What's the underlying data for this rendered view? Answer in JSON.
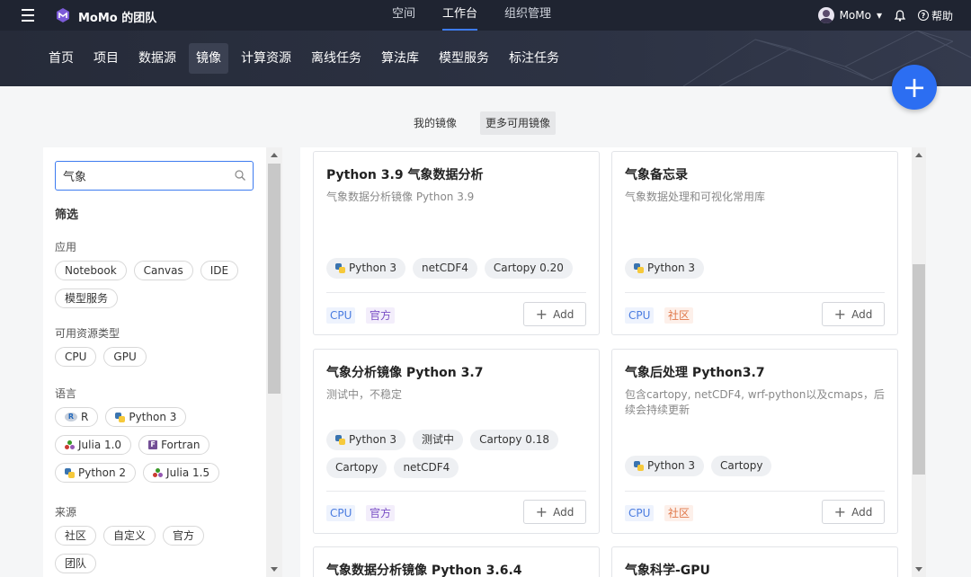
{
  "topbar": {
    "team_name": "MoMo 的团队",
    "nav": [
      "空间",
      "工作台",
      "组织管理"
    ],
    "active_nav": 1,
    "user_name": "MoMo",
    "user_chevron": "▾",
    "bell_glyph": "🔔",
    "help_glyph": "?",
    "help_label": "帮助"
  },
  "subnav": {
    "items": [
      "首页",
      "项目",
      "数据源",
      "镜像",
      "计算资源",
      "离线任务",
      "算法库",
      "模型服务",
      "标注任务"
    ],
    "active": 3
  },
  "fab": {
    "glyph": "+"
  },
  "tabs": {
    "mine": "我的镜像",
    "more": "更多可用镜像"
  },
  "filter": {
    "search_value": "气象",
    "title": "筛选",
    "app_label": "应用",
    "apps": [
      "Notebook",
      "Canvas",
      "IDE",
      "模型服务"
    ],
    "resource_label": "可用资源类型",
    "resources": [
      "CPU",
      "GPU"
    ],
    "lang_label": "语言",
    "langs": [
      "R",
      "Python 3",
      "Julia 1.0",
      "Fortran",
      "Python 2",
      "Julia 1.5"
    ],
    "source_label": "来源",
    "sources": [
      "社区",
      "自定义",
      "官方",
      "团队"
    ]
  },
  "cards": [
    {
      "title": "Python 3.9 气象数据分析",
      "desc": "气象数据分析镜像 Python 3.9",
      "tags": [
        "Python 3",
        "netCDF4",
        "Cartopy 0.20"
      ],
      "resource": "CPU",
      "source": "官方",
      "add": "Add"
    },
    {
      "title": "气象备忘录",
      "desc": "气象数据处理和可视化常用库",
      "tags": [
        "Python 3"
      ],
      "resource": "CPU",
      "source": "社区",
      "add": "Add"
    },
    {
      "title": "气象分析镜像 Python 3.7",
      "desc": "测试中，不稳定",
      "tags": [
        "Python 3",
        "测试中",
        "Cartopy 0.18",
        "Cartopy",
        "netCDF4"
      ],
      "resource": "CPU",
      "source": "官方",
      "add": "Add"
    },
    {
      "title": "气象后处理 Python3.7",
      "desc": "包含cartopy, netCDF4, wrf-python以及cmaps，后续会持续更新",
      "tags": [
        "Python 3",
        "Cartopy"
      ],
      "resource": "CPU",
      "source": "社区",
      "add": "Add"
    },
    {
      "title": "气象数据分析镜像 Python 3.6.4"
    },
    {
      "title": "气象科学-GPU"
    }
  ],
  "colors": {
    "topbar_bg": "#1f2431",
    "accent": "#2c6ef2",
    "official_text": "#7a4fc5",
    "community_text": "#e0784a"
  }
}
